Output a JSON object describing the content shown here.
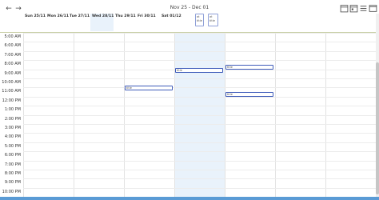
{
  "toolbar": {
    "prev_icon": "←",
    "next_icon": "→",
    "period": "Nov 25 - Dec 01",
    "icons": [
      "calendar-icon",
      "calendar-alt-icon",
      "menu-icon",
      "window-icon"
    ]
  },
  "days": [
    {
      "label": "Sun 25/11",
      "today": false
    },
    {
      "label": "Mon 26/11",
      "today": false
    },
    {
      "label": "Tue 27/11",
      "today": false
    },
    {
      "label": "Wed 28/11",
      "today": true
    },
    {
      "label": "Thu 29/11",
      "today": false
    },
    {
      "label": "Fri 30/11",
      "today": false
    },
    {
      "label": "Sat 01/12",
      "today": false
    }
  ],
  "allday_events": [
    {
      "lines": [
        "at",
        "title"
      ]
    },
    {
      "lines": [
        "at",
        "title"
      ]
    }
  ],
  "times": [
    "5:00 AM",
    "6:00 AM",
    "7:00 AM",
    "8:00 AM",
    "9:00 AM",
    "10:00 AM",
    "11:00 AM",
    "12:00 PM",
    "1:00 PM",
    "2:00 PM",
    "3:00 PM",
    "4:00 PM",
    "5:00 PM",
    "6:00 PM",
    "7:00 PM",
    "8:00 PM",
    "9:00 PM",
    "10:00 PM"
  ],
  "events": [
    {
      "title": "title"
    },
    {
      "title": "title"
    },
    {
      "title": "title"
    },
    {
      "title": "title"
    }
  ],
  "colors": {
    "today_bg": "#e9f2fb",
    "event_border": "#3f5cba",
    "taskbar": "#5a9bd5"
  }
}
